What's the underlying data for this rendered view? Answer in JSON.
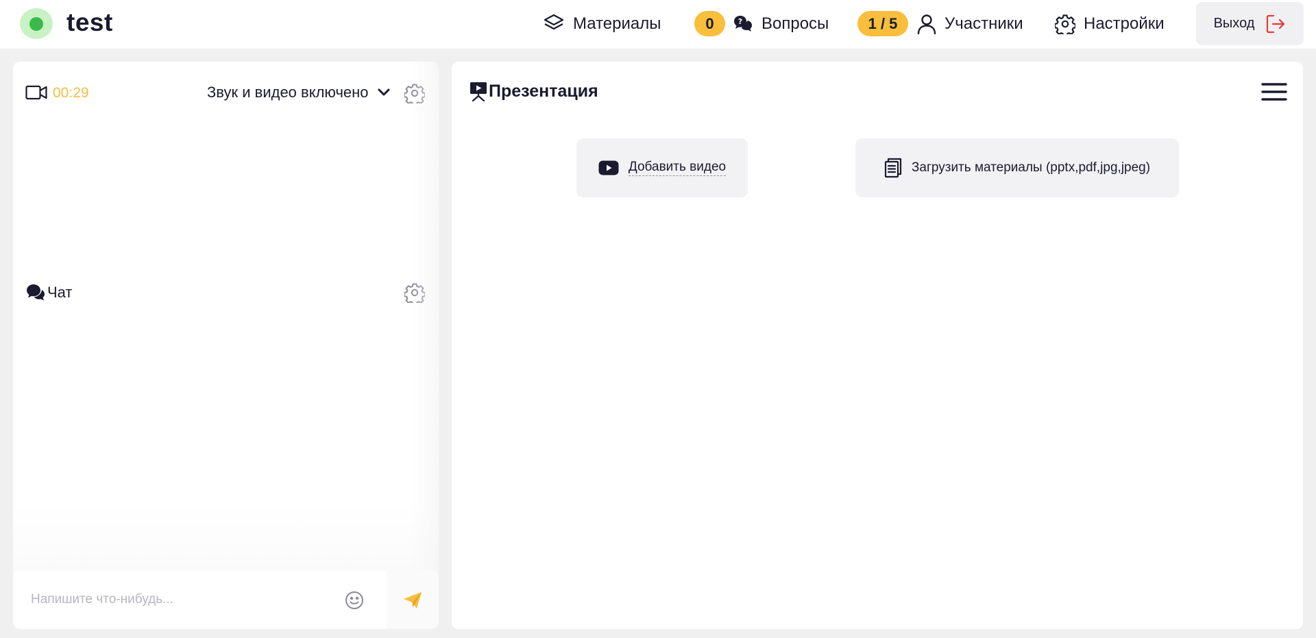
{
  "header": {
    "room_title": "test",
    "status": "online",
    "nav": {
      "materials_label": "Материалы",
      "questions_count": "0",
      "questions_label": "Вопросы",
      "participants_count": "1 / 5",
      "participants_label": "Участники",
      "settings_label": "Настройки"
    },
    "logout_label": "Выход"
  },
  "video": {
    "timer": "00:29",
    "status_label": "Звук и видео включено"
  },
  "chat": {
    "title": "Чат",
    "input_placeholder": "Напишите что-нибудь..."
  },
  "presentation": {
    "title": "Презентация",
    "add_video_label": "Добавить видео",
    "upload_label": "Загрузить материалы (pptx,pdf,jpg,jpeg)"
  },
  "colors": {
    "accent": "#f8be3c",
    "text": "#1b1a2e",
    "online": "#3db84a",
    "logout_icon": "#e53935"
  },
  "icons": [
    "layers-icon",
    "question-bubble-icon",
    "user-icon",
    "gear-icon",
    "logout-icon",
    "video-camera-icon",
    "chevron-down-icon",
    "chat-bubbles-icon",
    "emoji-icon",
    "send-icon",
    "presentation-icon",
    "hamburger-menu-icon",
    "youtube-icon",
    "documents-icon"
  ]
}
